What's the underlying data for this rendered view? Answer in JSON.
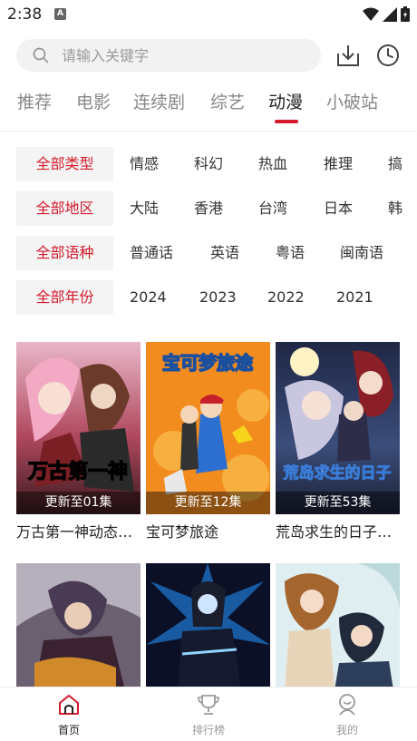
{
  "status": {
    "time": "2:38",
    "app_badge": "A"
  },
  "search": {
    "placeholder": "请输入关键字"
  },
  "tabs": [
    {
      "label": "推荐",
      "active": false
    },
    {
      "label": "电影",
      "active": false
    },
    {
      "label": "连续剧",
      "active": false
    },
    {
      "label": "综艺",
      "active": false
    },
    {
      "label": "动漫",
      "active": true
    },
    {
      "label": "小破站",
      "active": false
    }
  ],
  "filters": [
    {
      "head": "全部类型",
      "options": [
        "情感",
        "科幻",
        "热血",
        "推理",
        "搞"
      ]
    },
    {
      "head": "全部地区",
      "options": [
        "大陆",
        "香港",
        "台湾",
        "日本",
        "韩"
      ]
    },
    {
      "head": "全部语种",
      "options": [
        "普通话",
        "英语",
        "粤语",
        "闽南语"
      ]
    },
    {
      "head": "全部年份",
      "options": [
        "2024",
        "2023",
        "2022",
        "2021"
      ]
    }
  ],
  "cards": [
    {
      "title": "万古第一神动态…",
      "badge": "更新至01集",
      "poster_text": "万古第一神"
    },
    {
      "title": "宝可梦旅途",
      "badge": "更新至12集",
      "poster_text": "宝可梦旅途"
    },
    {
      "title": "荒岛求生的日子…",
      "badge": "更新至53集",
      "poster_text": "荒岛求生的日子"
    }
  ],
  "cards_row2": [
    {
      "poster_text": ""
    },
    {
      "poster_text": ""
    },
    {
      "poster_text": ""
    }
  ],
  "bottom_nav": [
    {
      "label": "首页",
      "icon": "home-icon",
      "active": true
    },
    {
      "label": "排行榜",
      "icon": "trophy-icon",
      "active": false
    },
    {
      "label": "我的",
      "icon": "profile-icon",
      "active": false
    }
  ],
  "colors": {
    "accent": "#d41a2c",
    "muted": "#888888"
  }
}
